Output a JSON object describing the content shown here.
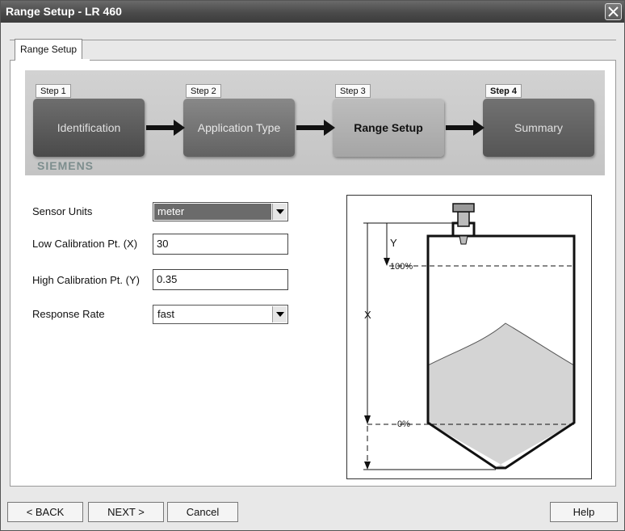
{
  "window": {
    "title": "Range Setup - LR 460"
  },
  "tabs": [
    {
      "label": "Range Setup"
    }
  ],
  "wizard": {
    "steps": [
      {
        "tag": "Step 1",
        "label": "Identification"
      },
      {
        "tag": "Step 2",
        "label": "Application Type"
      },
      {
        "tag": "Step 3",
        "label": "Range Setup"
      },
      {
        "tag": "Step 4",
        "label": "Summary"
      }
    ],
    "brand": "SIEMENS"
  },
  "form": {
    "sensor_units": {
      "label": "Sensor Units",
      "value": "meter"
    },
    "low_cal": {
      "label": "Low Calibration Pt. (X)",
      "value": "30"
    },
    "high_cal": {
      "label": "High Calibration Pt. (Y)",
      "value": "0.35"
    },
    "response_rate": {
      "label": "Response Rate",
      "value": "fast"
    }
  },
  "diagram": {
    "label_y": "Y",
    "label_x": "X",
    "label_100": "100%",
    "label_0": "0%"
  },
  "buttons": {
    "back": "< BACK",
    "next": "NEXT >",
    "cancel": "Cancel",
    "help": "Help"
  },
  "colors": {
    "titlebar": "#4a4a4a",
    "panel": "#c8c8c8",
    "selection": "#6b6b6b"
  }
}
